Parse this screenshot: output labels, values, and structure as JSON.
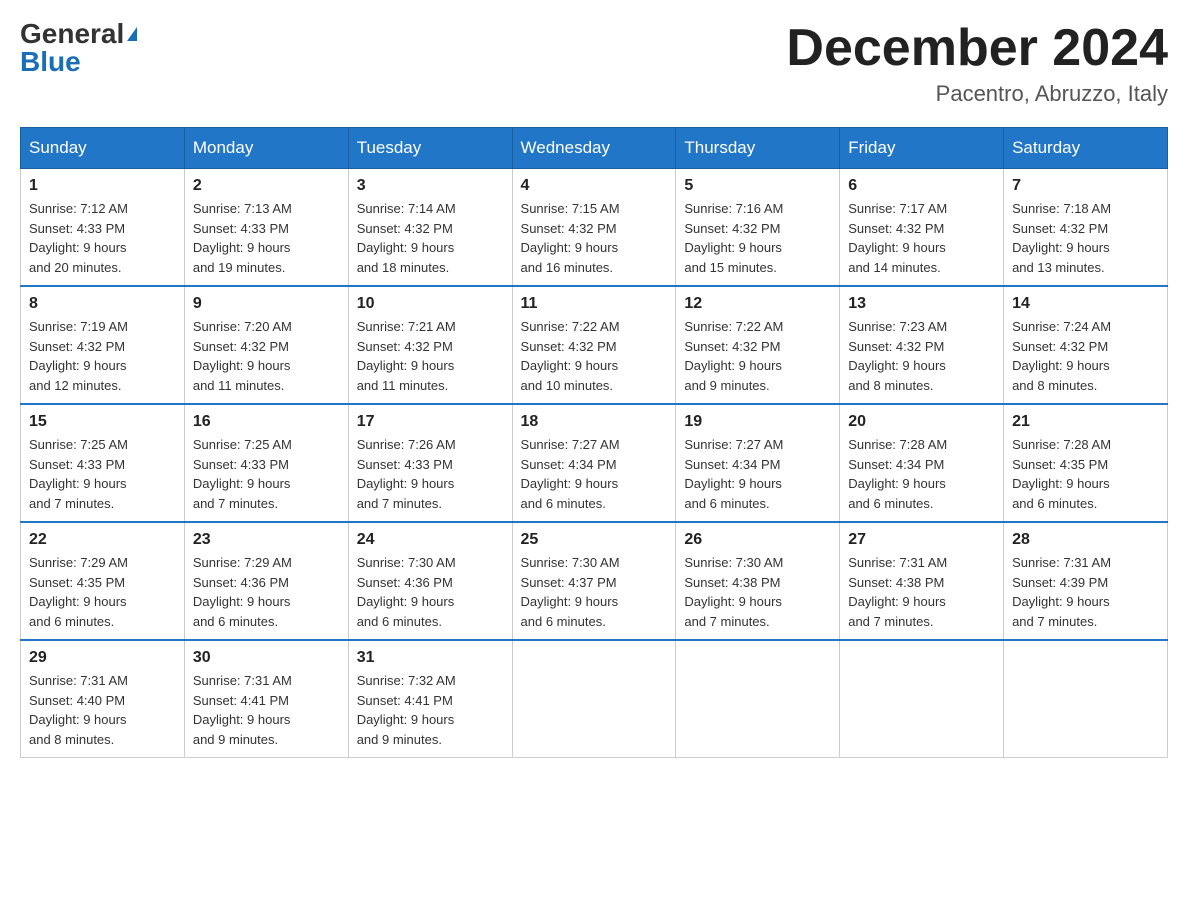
{
  "header": {
    "logo_general": "General",
    "logo_blue": "Blue",
    "month_title": "December 2024",
    "location": "Pacentro, Abruzzo, Italy"
  },
  "days_of_week": [
    "Sunday",
    "Monday",
    "Tuesday",
    "Wednesday",
    "Thursday",
    "Friday",
    "Saturday"
  ],
  "weeks": [
    [
      {
        "day": "1",
        "sunrise": "7:12 AM",
        "sunset": "4:33 PM",
        "daylight": "9 hours and 20 minutes."
      },
      {
        "day": "2",
        "sunrise": "7:13 AM",
        "sunset": "4:33 PM",
        "daylight": "9 hours and 19 minutes."
      },
      {
        "day": "3",
        "sunrise": "7:14 AM",
        "sunset": "4:32 PM",
        "daylight": "9 hours and 18 minutes."
      },
      {
        "day": "4",
        "sunrise": "7:15 AM",
        "sunset": "4:32 PM",
        "daylight": "9 hours and 16 minutes."
      },
      {
        "day": "5",
        "sunrise": "7:16 AM",
        "sunset": "4:32 PM",
        "daylight": "9 hours and 15 minutes."
      },
      {
        "day": "6",
        "sunrise": "7:17 AM",
        "sunset": "4:32 PM",
        "daylight": "9 hours and 14 minutes."
      },
      {
        "day": "7",
        "sunrise": "7:18 AM",
        "sunset": "4:32 PM",
        "daylight": "9 hours and 13 minutes."
      }
    ],
    [
      {
        "day": "8",
        "sunrise": "7:19 AM",
        "sunset": "4:32 PM",
        "daylight": "9 hours and 12 minutes."
      },
      {
        "day": "9",
        "sunrise": "7:20 AM",
        "sunset": "4:32 PM",
        "daylight": "9 hours and 11 minutes."
      },
      {
        "day": "10",
        "sunrise": "7:21 AM",
        "sunset": "4:32 PM",
        "daylight": "9 hours and 11 minutes."
      },
      {
        "day": "11",
        "sunrise": "7:22 AM",
        "sunset": "4:32 PM",
        "daylight": "9 hours and 10 minutes."
      },
      {
        "day": "12",
        "sunrise": "7:22 AM",
        "sunset": "4:32 PM",
        "daylight": "9 hours and 9 minutes."
      },
      {
        "day": "13",
        "sunrise": "7:23 AM",
        "sunset": "4:32 PM",
        "daylight": "9 hours and 8 minutes."
      },
      {
        "day": "14",
        "sunrise": "7:24 AM",
        "sunset": "4:32 PM",
        "daylight": "9 hours and 8 minutes."
      }
    ],
    [
      {
        "day": "15",
        "sunrise": "7:25 AM",
        "sunset": "4:33 PM",
        "daylight": "9 hours and 7 minutes."
      },
      {
        "day": "16",
        "sunrise": "7:25 AM",
        "sunset": "4:33 PM",
        "daylight": "9 hours and 7 minutes."
      },
      {
        "day": "17",
        "sunrise": "7:26 AM",
        "sunset": "4:33 PM",
        "daylight": "9 hours and 7 minutes."
      },
      {
        "day": "18",
        "sunrise": "7:27 AM",
        "sunset": "4:34 PM",
        "daylight": "9 hours and 6 minutes."
      },
      {
        "day": "19",
        "sunrise": "7:27 AM",
        "sunset": "4:34 PM",
        "daylight": "9 hours and 6 minutes."
      },
      {
        "day": "20",
        "sunrise": "7:28 AM",
        "sunset": "4:34 PM",
        "daylight": "9 hours and 6 minutes."
      },
      {
        "day": "21",
        "sunrise": "7:28 AM",
        "sunset": "4:35 PM",
        "daylight": "9 hours and 6 minutes."
      }
    ],
    [
      {
        "day": "22",
        "sunrise": "7:29 AM",
        "sunset": "4:35 PM",
        "daylight": "9 hours and 6 minutes."
      },
      {
        "day": "23",
        "sunrise": "7:29 AM",
        "sunset": "4:36 PM",
        "daylight": "9 hours and 6 minutes."
      },
      {
        "day": "24",
        "sunrise": "7:30 AM",
        "sunset": "4:36 PM",
        "daylight": "9 hours and 6 minutes."
      },
      {
        "day": "25",
        "sunrise": "7:30 AM",
        "sunset": "4:37 PM",
        "daylight": "9 hours and 6 minutes."
      },
      {
        "day": "26",
        "sunrise": "7:30 AM",
        "sunset": "4:38 PM",
        "daylight": "9 hours and 7 minutes."
      },
      {
        "day": "27",
        "sunrise": "7:31 AM",
        "sunset": "4:38 PM",
        "daylight": "9 hours and 7 minutes."
      },
      {
        "day": "28",
        "sunrise": "7:31 AM",
        "sunset": "4:39 PM",
        "daylight": "9 hours and 7 minutes."
      }
    ],
    [
      {
        "day": "29",
        "sunrise": "7:31 AM",
        "sunset": "4:40 PM",
        "daylight": "9 hours and 8 minutes."
      },
      {
        "day": "30",
        "sunrise": "7:31 AM",
        "sunset": "4:41 PM",
        "daylight": "9 hours and 9 minutes."
      },
      {
        "day": "31",
        "sunrise": "7:32 AM",
        "sunset": "4:41 PM",
        "daylight": "9 hours and 9 minutes."
      },
      null,
      null,
      null,
      null
    ]
  ],
  "labels": {
    "sunrise": "Sunrise:",
    "sunset": "Sunset:",
    "daylight": "Daylight:"
  }
}
